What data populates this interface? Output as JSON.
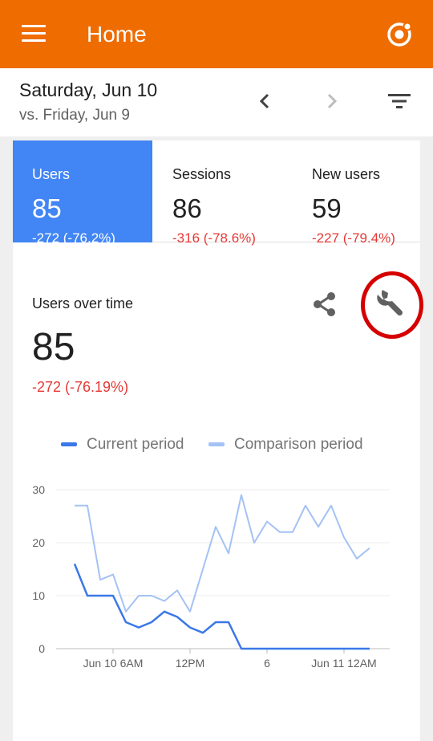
{
  "appbar": {
    "title": "Home",
    "menu_icon": "menu-icon",
    "sync_icon": "sync-icon",
    "color": "#ef6c00"
  },
  "date_bar": {
    "date": "Saturday, Jun 10",
    "comparison": "vs. Friday, Jun 9"
  },
  "tiles": [
    {
      "label": "Users",
      "value": "85",
      "change": "-272 (-76.2%)",
      "selected": true
    },
    {
      "label": "Sessions",
      "value": "86",
      "change": "-316 (-78.6%)",
      "selected": false
    },
    {
      "label": "New users",
      "value": "59",
      "change": "-227 (-79.4%)",
      "selected": false
    }
  ],
  "section": {
    "title": "Users over time",
    "value": "85",
    "change": "-272 (-76.19%)"
  },
  "legend": {
    "current": "Current period",
    "comparison": "Comparison period"
  },
  "colors": {
    "current": "#3b78e7",
    "comparison": "#a4c2f4",
    "negative": "#e53935",
    "selected_tile": "#4285f4"
  },
  "chart_data": {
    "type": "line",
    "ylim": [
      0,
      30
    ],
    "yticks": [
      0,
      10,
      20,
      30
    ],
    "x_tick_labels": [
      {
        "x": 3,
        "label": "Jun 10 6AM"
      },
      {
        "x": 9,
        "label": "12PM"
      },
      {
        "x": 15,
        "label": "6"
      },
      {
        "x": 21,
        "label": "Jun 11 12AM"
      }
    ],
    "grid": true,
    "legend": "top",
    "series": [
      {
        "name": "Current period",
        "values": [
          16,
          10,
          10,
          10,
          5,
          4,
          5,
          7,
          6,
          4,
          3,
          5,
          5,
          0,
          0,
          0,
          0,
          0,
          0,
          0,
          0,
          0,
          0,
          0
        ]
      },
      {
        "name": "Comparison period",
        "values": [
          27,
          27,
          13,
          14,
          7,
          10,
          10,
          9,
          11,
          7,
          15,
          23,
          18,
          29,
          20,
          24,
          22,
          22,
          27,
          23,
          27,
          21,
          17,
          19
        ]
      }
    ]
  }
}
